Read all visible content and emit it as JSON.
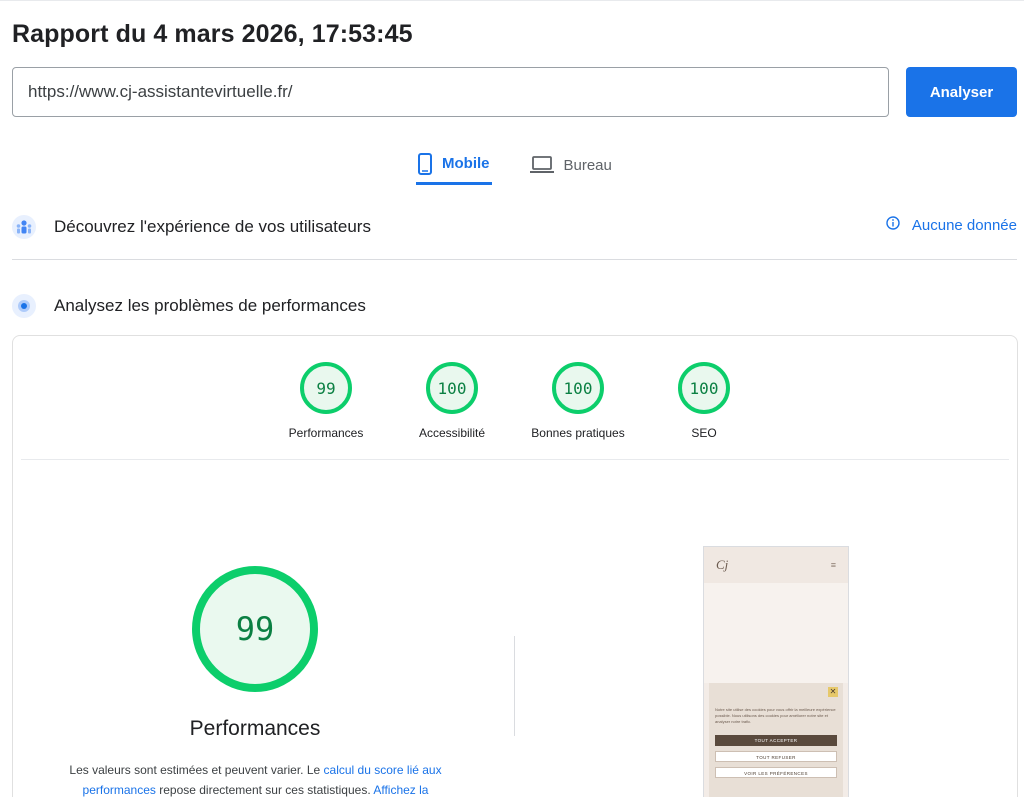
{
  "report": {
    "title": "Rapport du 4 mars 2026, 17:53:45"
  },
  "search": {
    "url": "https://www.cj-assistantevirtuelle.fr/",
    "button_label": "Analyser"
  },
  "tabs": [
    {
      "label": "Mobile",
      "icon": "smartphone-icon",
      "active": true
    },
    {
      "label": "Bureau",
      "icon": "laptop-icon",
      "active": false
    }
  ],
  "sections": {
    "users": {
      "label": "Découvrez l'expérience de vos utilisateurs",
      "status_label": "Aucune donnée",
      "icon": "users-icon"
    },
    "performance": {
      "label": "Analysez les problèmes de performances",
      "icon": "lighthouse-icon"
    }
  },
  "scores": [
    {
      "value": "99",
      "label": "Performances"
    },
    {
      "value": "100",
      "label": "Accessibilité"
    },
    {
      "value": "100",
      "label": "Bonnes pratiques"
    },
    {
      "value": "100",
      "label": "SEO"
    }
  ],
  "main_gauge": {
    "value": "99",
    "label": "Performances",
    "desc_part1": "Les valeurs sont estimées et peuvent varier. Le ",
    "desc_link1": "calcul du score lié aux performances",
    "desc_part2": " repose directement sur ces statistiques. ",
    "desc_link2": "Affichez la"
  },
  "preview": {
    "logo": "Cj",
    "cookie_text": "Notre site utilise des cookies pour vous offrir la meilleure expérience possible. Nous utilisons des cookies pour améliorer notre site et analyser notre trafic.",
    "accept_label": "TOUT ACCEPTER",
    "refuse_label": "TOUT REFUSER",
    "prefs_label": "VOIR LES PRÉFÉRENCES"
  },
  "colors": {
    "accent": "#1a73e8",
    "pass": "#0cce6b",
    "pass_text": "#0b8043"
  }
}
